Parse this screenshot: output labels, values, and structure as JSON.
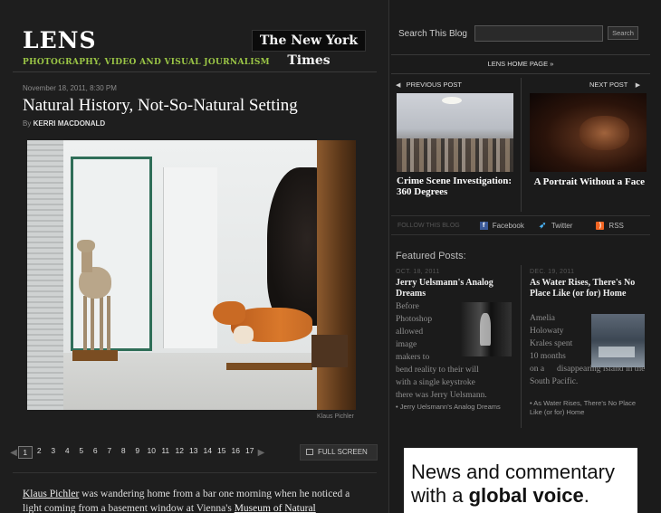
{
  "header": {
    "logo": "LENS",
    "brand": "The New York Times",
    "tagline": "PHOTOGRAPHY, VIDEO AND VISUAL JOURNALISM"
  },
  "post": {
    "date": "November 18, 2011, 8:30 PM",
    "title": "Natural History, Not-So-Natural Setting",
    "byline_prefix": "By",
    "author": "KERRI MACDONALD",
    "photo_credit": "Klaus Pichler"
  },
  "pager": {
    "prev_arrow": "◀",
    "next_arrow": "▶",
    "pages": [
      "1",
      "2",
      "3",
      "4",
      "5",
      "6",
      "7",
      "8",
      "9",
      "10",
      "11",
      "12",
      "13",
      "14",
      "15",
      "16",
      "17"
    ],
    "active_page": "1",
    "fullscreen_label": "FULL SCREEN"
  },
  "article": {
    "link1": "Klaus Pichler",
    "text1": " was wandering home from a bar one morning when he noticed a light coming from a basement window at Vienna's ",
    "link2": "Museum of Natural"
  },
  "sidebar": {
    "search_label": "Search This Blog",
    "search_value": "",
    "search_button": "Search",
    "home_link": "LENS HOME PAGE »",
    "previous_label": "PREVIOUS POST",
    "next_label": "NEXT POST",
    "prev_arrow": "◀",
    "next_arrow": "▶",
    "previous_title": "Crime Scene Investigation: 360 Degrees",
    "next_title": "A Portrait Without a Face",
    "follow_label": "FOLLOW THIS BLOG",
    "facebook": "Facebook",
    "twitter": "Twitter",
    "rss": "RSS",
    "featured_heading": "Featured Posts:",
    "featured": [
      {
        "date": "OCT. 18, 2011",
        "title": "Jerry Uelsmann's Analog Dreams",
        "text_narrow": [
          "Before",
          "Photoshop",
          "allowed",
          "image",
          "makers to"
        ],
        "text_wide": [
          "bend reality to their will",
          "with a single keystroke",
          "there was Jerry Uelsmann."
        ],
        "link": "Jerry Uelsmann's Analog Dreams"
      },
      {
        "date": "DEC. 19, 2011",
        "title": "As Water Rises, There's No Place Like (or for) Home",
        "text_narrow": [
          "Amelia",
          "Holowaty",
          "Krales spent",
          "10 months",
          "on a"
        ],
        "text_wide": [
          "disappearing island in the",
          "South Pacific."
        ],
        "link": "As Water Rises, There's No Place Like (or for) Home"
      }
    ]
  },
  "ad": {
    "line1": "News and commentary",
    "line2_prefix": "with a ",
    "line2_strong": "global voice",
    "line2_suffix": "."
  },
  "colors": {
    "background": "#1b1b1b",
    "tagline_green": "#9bc646",
    "facebook_blue": "#3b5998",
    "rss_orange": "#f26522"
  }
}
